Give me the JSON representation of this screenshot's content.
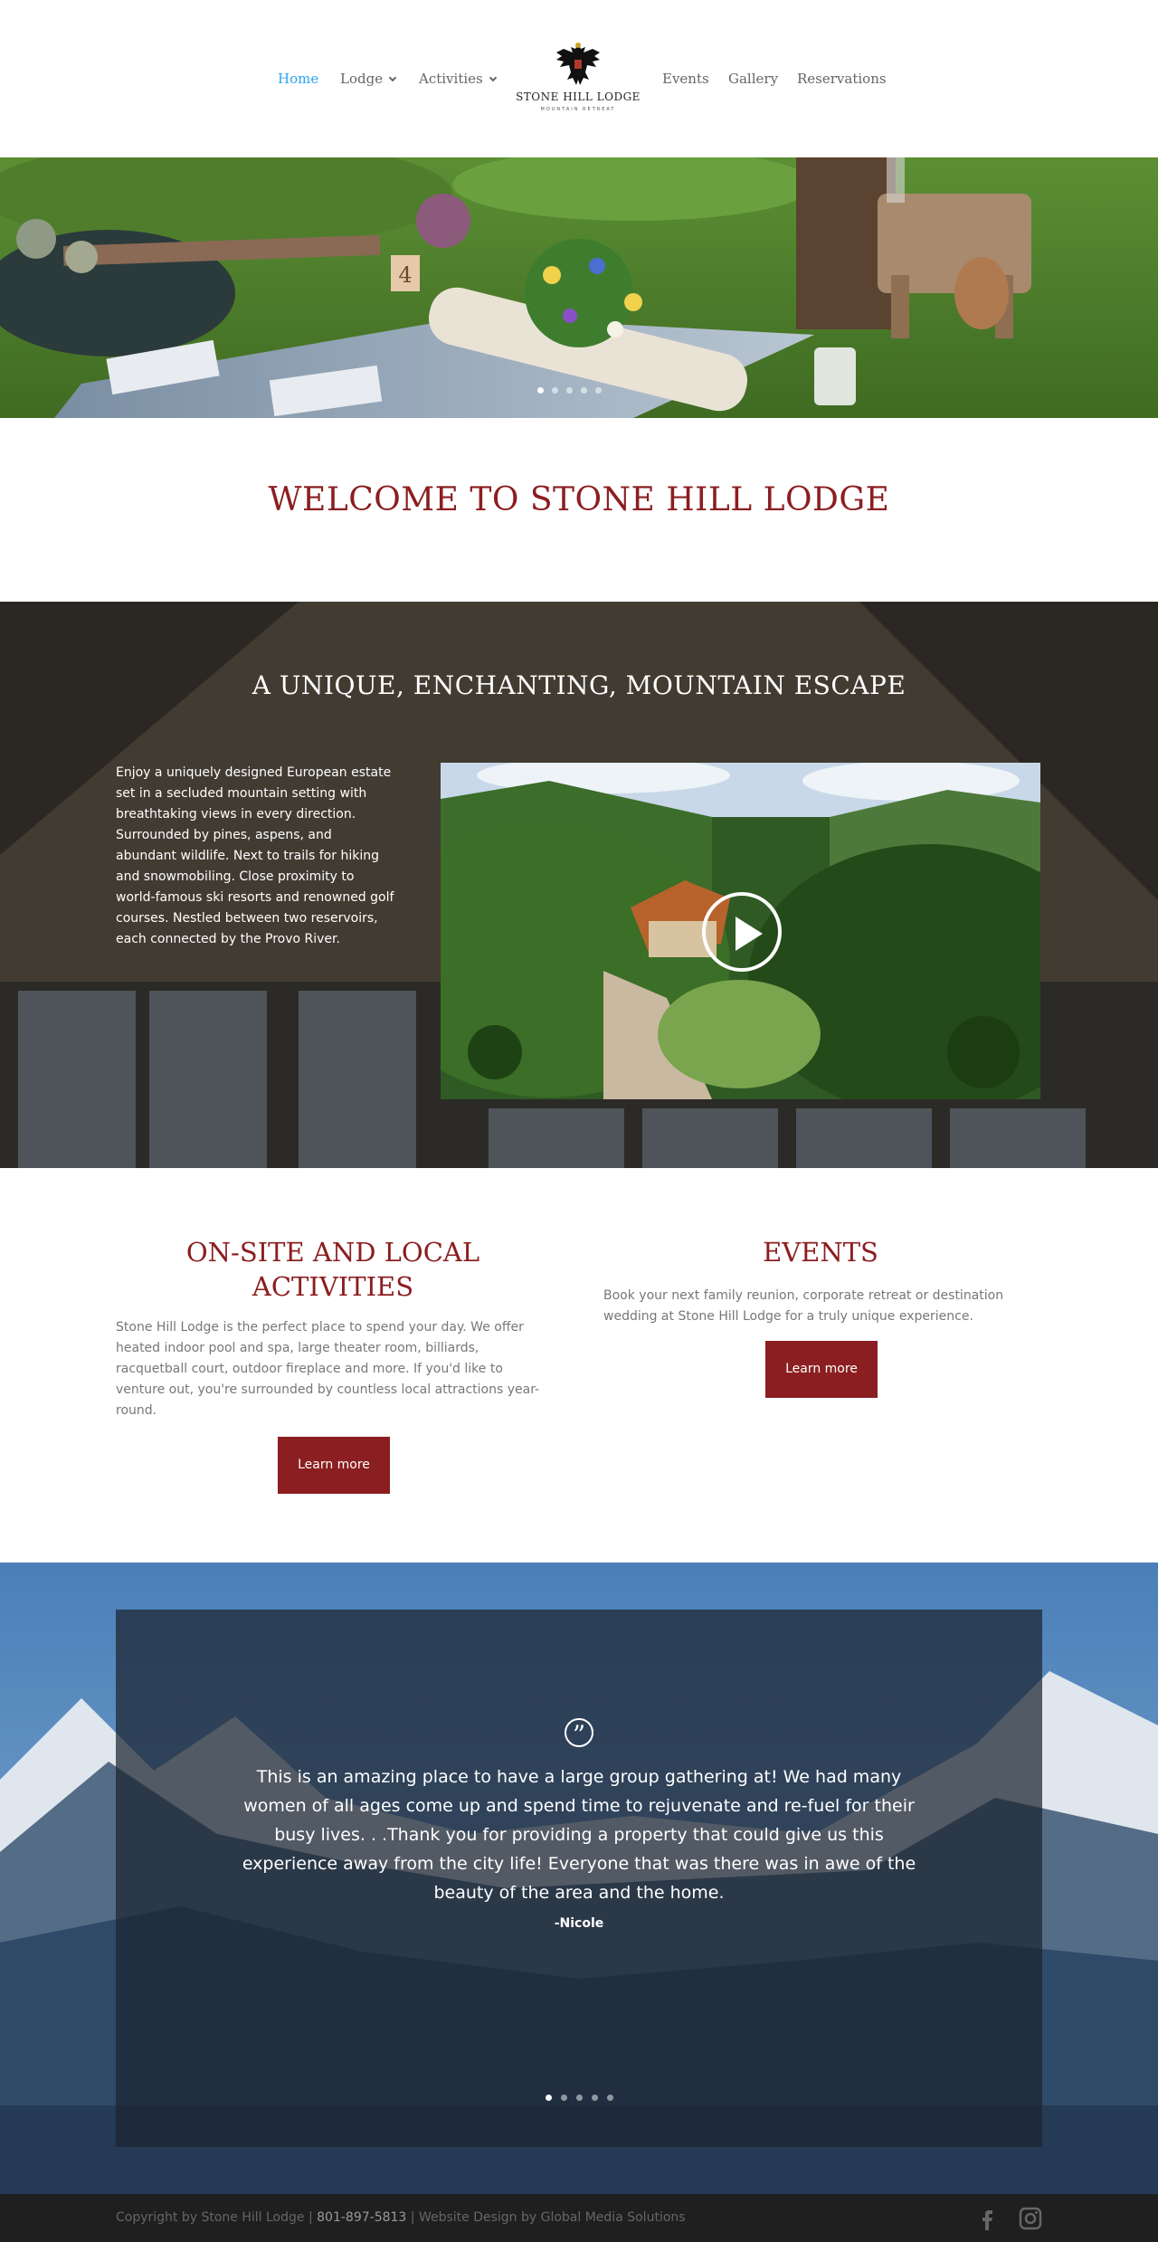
{
  "header": {
    "nav_left": [
      {
        "label": "Home",
        "active": true,
        "dropdown": false
      },
      {
        "label": "Lodge",
        "active": false,
        "dropdown": true
      },
      {
        "label": "Activities",
        "active": false,
        "dropdown": true
      }
    ],
    "nav_right": [
      {
        "label": "Events"
      },
      {
        "label": "Gallery"
      },
      {
        "label": "Reservations"
      }
    ],
    "logo": {
      "name": "STONE HILL LODGE",
      "tagline": "MOUNTAIN RETREAT",
      "icon": "eagle-crest-icon"
    }
  },
  "hero": {
    "slides_count": 5,
    "active_slide": 1,
    "table_number": "4"
  },
  "welcome": {
    "title": "WELCOME TO STONE HILL LODGE"
  },
  "escape": {
    "title": "A UNIQUE, ENCHANTING, MOUNTAIN ESCAPE",
    "text": "Enjoy a uniquely designed European estate set in a secluded mountain setting with breathtaking views in every direction. Surrounded by pines, aspens, and abundant wildlife. Next to trails for hiking and snowmobiling. Close proximity to world-famous ski resorts and renowned golf courses. Nestled between two reservoirs, each connected by the Provo River.",
    "video_icon": "play-icon"
  },
  "features": {
    "activities": {
      "title": "ON-SITE AND LOCAL ACTIVITIES",
      "text": "Stone Hill Lodge is the perfect place to spend your day. We offer heated indoor pool and spa, large theater room, billiards, racquetball court, outdoor fireplace and more. If you'd like to venture out, you're surrounded by countless local attractions year-round.",
      "button": "Learn more"
    },
    "events": {
      "title": "EVENTS",
      "text": "Book your next family reunion, corporate retreat or destination wedding at Stone Hill Lodge for a truly unique experience.",
      "button": "Learn more"
    }
  },
  "testimonial": {
    "quote": "This is an amazing place to have a large group gathering at! We had many women of all ages come up and spend time to rejuvenate and re-fuel for their busy lives. . .Thank you for providing a property that could give us this experience away from the city life! Everyone that was there was in awe of the beauty of the area and the home.",
    "author": "-Nicole",
    "slides_count": 5,
    "active_slide": 1,
    "icon": "quote-icon"
  },
  "footer": {
    "copyright": "Copyright by Stone Hill Lodge |",
    "phone": "801-897-5813",
    "credit": "| Website Design by Global Media Solutions",
    "social": [
      "facebook-icon",
      "instagram-icon"
    ]
  },
  "colors": {
    "accent": "#8b1e20",
    "nav_active": "#2ea3f2",
    "footer_bg": "#1f1f1f"
  }
}
